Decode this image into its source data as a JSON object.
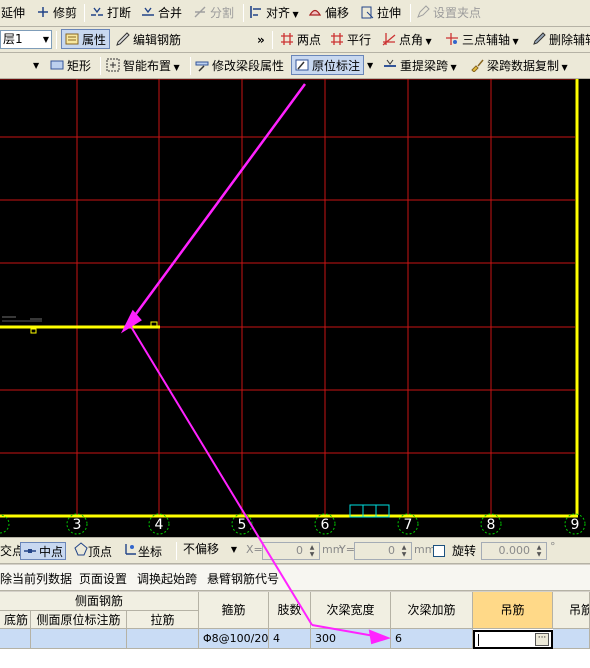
{
  "toolbar1": {
    "extend": "延伸",
    "trim": "修剪",
    "break": "打断",
    "merge": "合并",
    "split": "分割",
    "align": "对齐",
    "offset": "偏移",
    "stretch": "拉伸",
    "set_grip": "设置夹点"
  },
  "toolbar2": {
    "layer_value": "层1",
    "properties": "属性",
    "edit_rebar": "编辑钢筋",
    "more": "»",
    "two_points": "两点",
    "parallel": "平行",
    "point_angle": "点角",
    "three_point_aux": "三点辅轴",
    "delete_aux": "删除辅轴"
  },
  "toolbar3": {
    "rectangle": "矩形",
    "smart_layout": "智能布置",
    "modify_span_props": "修改梁段属性",
    "in_place_annotation": "原位标注",
    "re_extract_span": "重提梁跨",
    "copy_span_data": "梁跨数据复制"
  },
  "canvas": {
    "axis_labels": [
      "3",
      "4",
      "5",
      "6",
      "7",
      "8",
      "9"
    ],
    "colors": {
      "grid": "#c81414",
      "beam": "#ffff00",
      "axis_circle": "#00c800",
      "annotation_arrow": "#ff22ff",
      "background": "#000000"
    }
  },
  "snapbar": {
    "intersection": "交点",
    "midpoint": "中点",
    "vertex": "顶点",
    "coordinate": "坐标",
    "offset_mode": "不偏移",
    "x_label": "X=",
    "x_value": "0",
    "y_label": "Y=",
    "y_value": "0",
    "unit": "mm",
    "rotate": "旋转",
    "rotate_value": "0.000",
    "degree": "°"
  },
  "menubar": {
    "delete_column_data": "除当前列数据",
    "page_setup": "页面设置",
    "adjust_start_span": "调换起始跨",
    "cantilever_code": "悬臂钢筋代号"
  },
  "grid": {
    "group_side_rebar": "侧面钢筋",
    "headers": {
      "col0": "底筋",
      "side_inplace": "侧面原位标注筋",
      "tie": "拉筋",
      "stirrup": "箍筋",
      "legs": "肢数",
      "secondary_width": "次梁宽度",
      "secondary_add": "次梁加筋",
      "hanger": "吊筋",
      "hanger2": "吊筋"
    },
    "row": {
      "stirrup": "Φ8@100/20",
      "legs": "4",
      "secondary_width": "300",
      "secondary_add": "6",
      "hanger": ""
    }
  }
}
